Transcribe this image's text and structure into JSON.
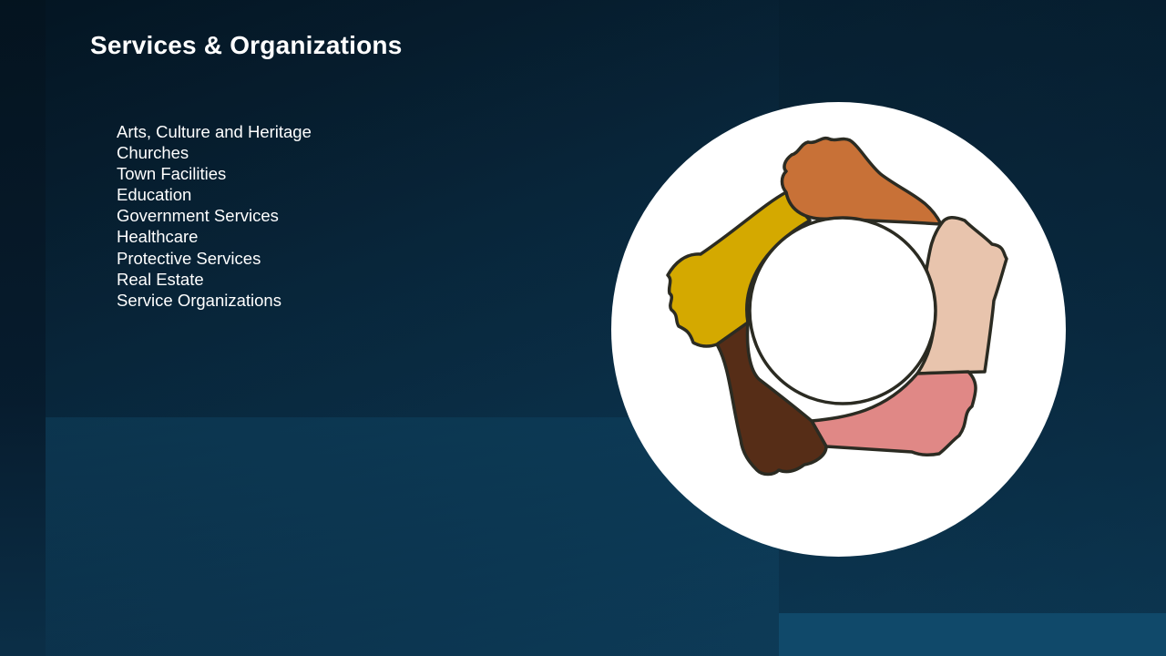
{
  "slide": {
    "title": "Services & Organizations",
    "items": [
      "Arts, Culture and Heritage",
      "Churches",
      "Town Facilities",
      "Education",
      "Government Services",
      "Healthcare",
      "Protective Services",
      "Real Estate",
      "Service Organizations"
    ]
  },
  "illustration": {
    "icon": "hands-circle-icon",
    "colors": {
      "background": "#ffffff",
      "outline": "#2b2b22",
      "hand_orange": "#c87137",
      "hand_peach": "#e8c4ad",
      "hand_pink": "#e08886",
      "hand_brown": "#562d17",
      "hand_gold": "#d4a900"
    }
  },
  "theme": {
    "background": "#0b2a3f",
    "text": "#ffffff"
  }
}
